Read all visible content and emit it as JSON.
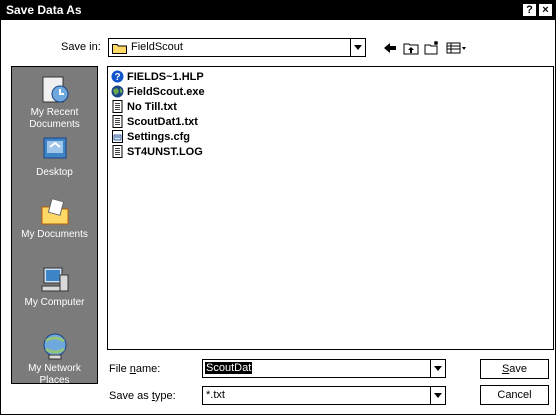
{
  "window": {
    "title": "Save Data As",
    "help_glyph": "?",
    "close_glyph": "×"
  },
  "save_in": {
    "label": "Save in:",
    "value": "FieldScout"
  },
  "places": [
    {
      "label": "My Recent Documents",
      "icon": "recent-documents-icon"
    },
    {
      "label": "Desktop",
      "icon": "desktop-icon"
    },
    {
      "label": "My Documents",
      "icon": "my-documents-icon"
    },
    {
      "label": "My Computer",
      "icon": "my-computer-icon"
    },
    {
      "label": "My Network Places",
      "icon": "network-places-icon"
    }
  ],
  "files": [
    {
      "name": "FIELDS~1.HLP",
      "icon": "help-file-icon"
    },
    {
      "name": "FieldScout.exe",
      "icon": "app-globe-icon"
    },
    {
      "name": "No Till.txt",
      "icon": "text-file-icon"
    },
    {
      "name": "ScoutDat1.txt",
      "icon": "text-file-icon"
    },
    {
      "name": "Settings.cfg",
      "icon": "config-file-icon"
    },
    {
      "name": "ST4UNST.LOG",
      "icon": "text-file-icon"
    }
  ],
  "file_name": {
    "label_pre": "File ",
    "label_u": "n",
    "label_post": "ame:",
    "value": "ScoutDat"
  },
  "save_as_type": {
    "label_pre": "Save as ",
    "label_u": "t",
    "label_post": "ype:",
    "value": "*.txt"
  },
  "buttons": {
    "save_u": "S",
    "save_rest": "ave",
    "cancel": "Cancel"
  }
}
